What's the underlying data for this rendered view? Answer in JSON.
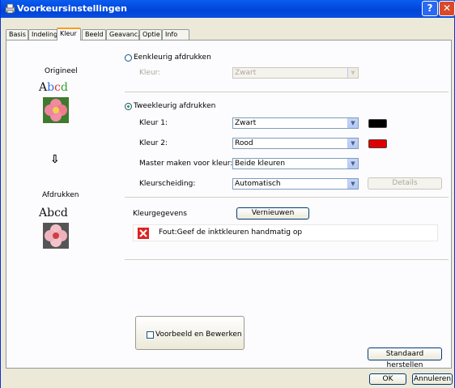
{
  "window": {
    "title": "Voorkeursinstellingen",
    "help": "?",
    "close": "✕"
  },
  "tabs": [
    "Basis",
    "Indeling",
    "Kleur",
    "Beeld",
    "Geavanc.",
    "Optie",
    "Info"
  ],
  "preview": {
    "original_label": "Origineel",
    "sample_text": "Abcd",
    "sample_letters": [
      "A",
      "b",
      "c",
      "d"
    ],
    "arrow": "⇩",
    "output_label": "Afdrukken"
  },
  "mono": {
    "radio_label": "Eenkleurig afdrukken",
    "color_label": "Kleur:",
    "color_value": "Zwart"
  },
  "duo": {
    "radio_label": "Tweekleurig afdrukken",
    "color1_label": "Kleur 1:",
    "color1_value": "Zwart",
    "color2_label": "Kleur 2:",
    "color2_value": "Rood",
    "master_label": "Master maken voor kleur:",
    "master_value": "Beide kleuren",
    "sep_label": "Kleurscheiding:",
    "sep_value": "Automatisch",
    "details_button": "Details"
  },
  "colors": {
    "swatch1": "#000000",
    "swatch2": "#e00000",
    "error_icon": "#e02020"
  },
  "color_data": {
    "label": "Kleurgegevens",
    "refresh_button": "Vernieuwen",
    "error_message": "Fout:Geef de inktkleuren handmatig op"
  },
  "preview_edit": {
    "checkbox_label": "Voorbeeld en Bewerken"
  },
  "buttons": {
    "restore": "Standaard herstellen",
    "ok": "OK",
    "cancel": "Annuleren"
  }
}
